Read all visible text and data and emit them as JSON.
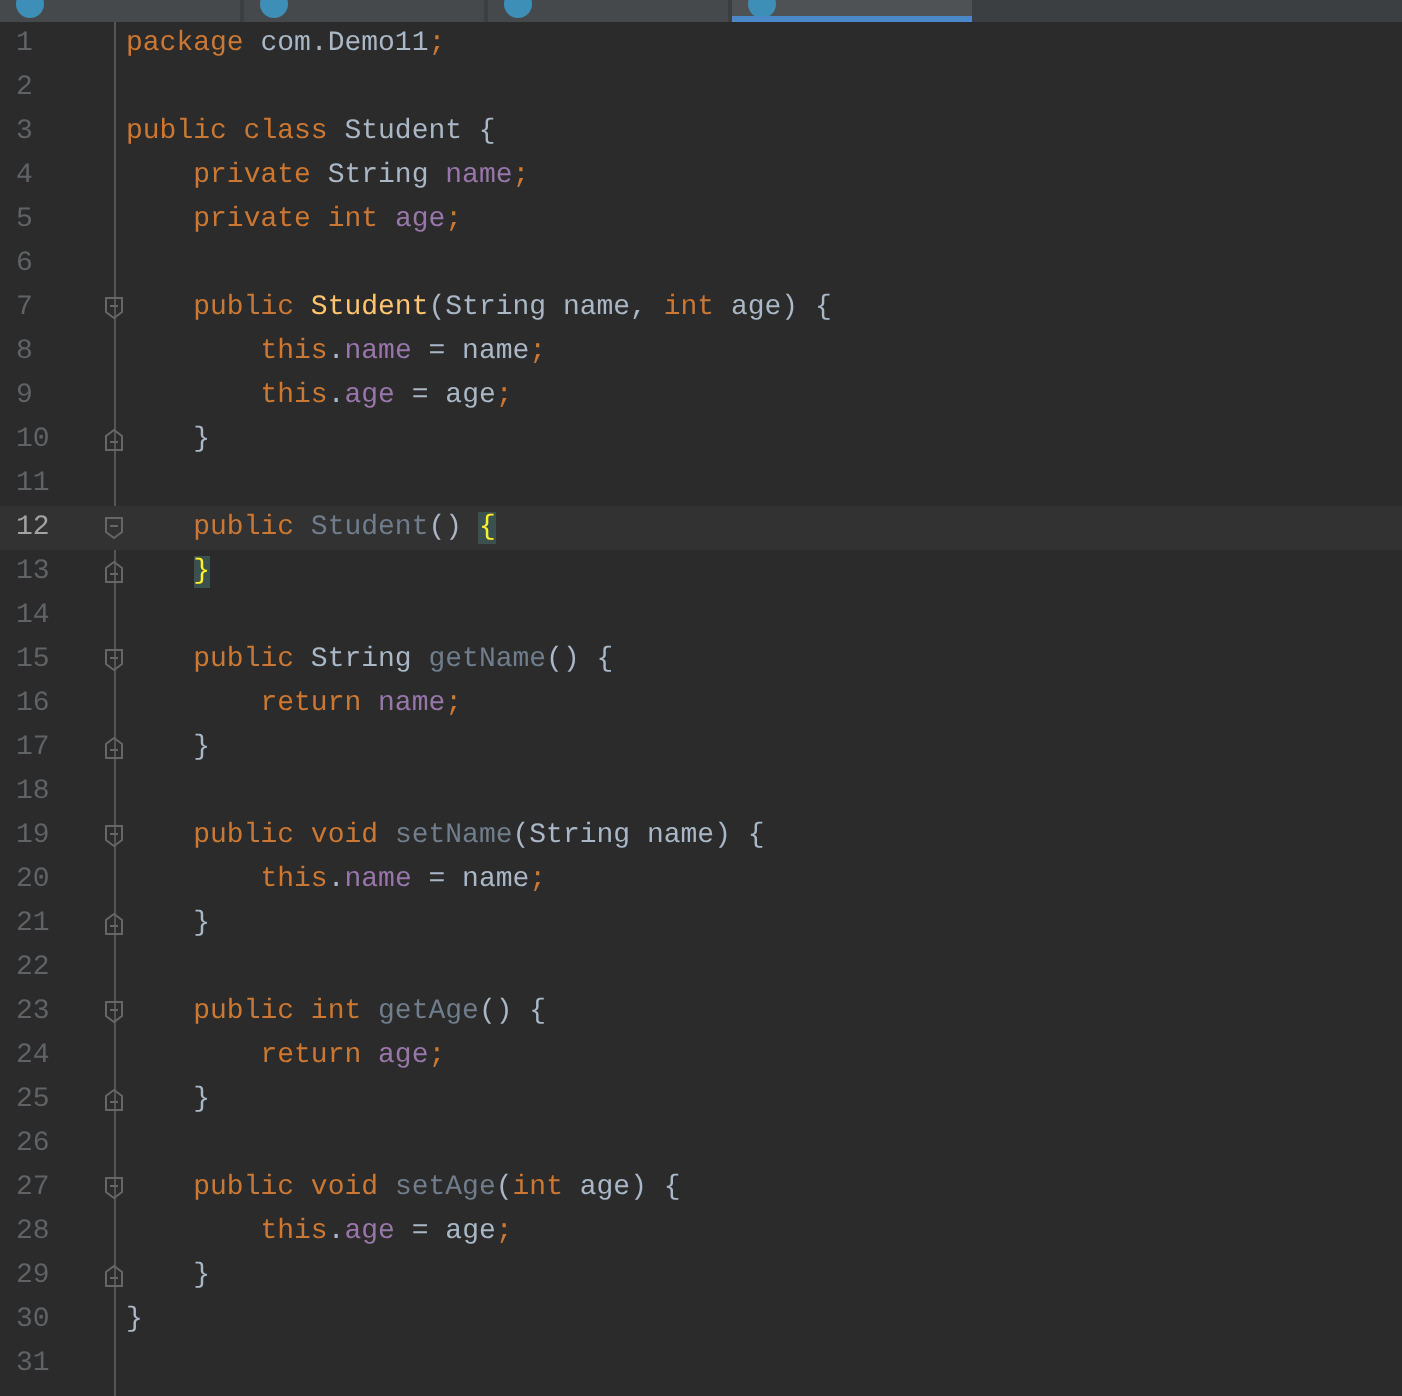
{
  "tabs": [
    {
      "selected": false
    },
    {
      "selected": false
    },
    {
      "selected": false
    },
    {
      "selected": true
    }
  ],
  "editor": {
    "lines": [
      {
        "number": "1",
        "current": false,
        "block_start": false,
        "block_end": false,
        "tokens": [
          {
            "text": "package ",
            "kind": "kw"
          },
          {
            "text": "com.Demo11",
            "kind": "plain"
          },
          {
            "text": ";",
            "kind": "kw"
          }
        ]
      },
      {
        "number": "2",
        "current": false,
        "block_start": false,
        "block_end": false
      },
      {
        "number": "3",
        "current": false,
        "block_start": false,
        "block_end": false,
        "tokens": [
          {
            "text": "public class ",
            "kind": "kw"
          },
          {
            "text": "Student {",
            "kind": "plain"
          }
        ]
      },
      {
        "number": "4",
        "current": false,
        "block_start": false,
        "block_end": false,
        "tokens": [
          {
            "text": "    private ",
            "kind": "kw"
          },
          {
            "text": "String ",
            "kind": "plain"
          },
          {
            "text": "name",
            "kind": "field"
          },
          {
            "text": ";",
            "kind": "kw"
          }
        ]
      },
      {
        "number": "5",
        "current": false,
        "block_start": false,
        "block_end": false,
        "tokens": [
          {
            "text": "    private int ",
            "kind": "kw"
          },
          {
            "text": "age",
            "kind": "field"
          },
          {
            "text": ";",
            "kind": "kw"
          }
        ]
      },
      {
        "number": "6",
        "current": false,
        "block_start": false,
        "block_end": false
      },
      {
        "number": "7",
        "current": false,
        "block_start": true,
        "block_end": false,
        "tokens": [
          {
            "text": "    public ",
            "kind": "kw"
          },
          {
            "text": "Student",
            "kind": "decl"
          },
          {
            "text": "(String name, ",
            "kind": "plain"
          },
          {
            "text": "int ",
            "kind": "kw"
          },
          {
            "text": "age) {",
            "kind": "plain"
          }
        ]
      },
      {
        "number": "8",
        "current": false,
        "block_start": false,
        "block_end": false,
        "tokens": [
          {
            "text": "        this",
            "kind": "kw"
          },
          {
            "text": ".",
            "kind": "plain"
          },
          {
            "text": "name",
            "kind": "field"
          },
          {
            "text": " = name",
            "kind": "plain"
          },
          {
            "text": ";",
            "kind": "kw"
          }
        ]
      },
      {
        "number": "9",
        "current": false,
        "block_start": false,
        "block_end": false,
        "tokens": [
          {
            "text": "        this",
            "kind": "kw"
          },
          {
            "text": ".",
            "kind": "plain"
          },
          {
            "text": "age",
            "kind": "field"
          },
          {
            "text": " = age",
            "kind": "plain"
          },
          {
            "text": ";",
            "kind": "kw"
          }
        ]
      },
      {
        "number": "10",
        "current": false,
        "block_start": false,
        "block_end": true,
        "tokens": [
          {
            "text": "    }",
            "kind": "plain"
          }
        ]
      },
      {
        "number": "11",
        "current": false,
        "block_start": false,
        "block_end": false
      },
      {
        "number": "12",
        "current": true,
        "block_start": true,
        "block_end": false,
        "tokens": [
          {
            "text": "    public ",
            "kind": "kw"
          },
          {
            "text": "Student",
            "kind": "unused"
          },
          {
            "text": "() ",
            "kind": "plain"
          },
          {
            "text": "{",
            "kind": "match"
          }
        ]
      },
      {
        "number": "13",
        "current": false,
        "block_start": false,
        "block_end": true,
        "tokens": [
          {
            "text": "    }",
            "kind": "match"
          }
        ]
      },
      {
        "number": "14",
        "current": false,
        "block_start": false,
        "block_end": false
      },
      {
        "number": "15",
        "current": false,
        "block_start": true,
        "block_end": false,
        "tokens": [
          {
            "text": "    public ",
            "kind": "kw"
          },
          {
            "text": "String ",
            "kind": "plain"
          },
          {
            "text": "getName",
            "kind": "unused"
          },
          {
            "text": "() {",
            "kind": "plain"
          }
        ]
      },
      {
        "number": "16",
        "current": false,
        "block_start": false,
        "block_end": false,
        "tokens": [
          {
            "text": "        return ",
            "kind": "kw"
          },
          {
            "text": "name",
            "kind": "field"
          },
          {
            "text": ";",
            "kind": "kw"
          }
        ]
      },
      {
        "number": "17",
        "current": false,
        "block_start": false,
        "block_end": true,
        "tokens": [
          {
            "text": "    }",
            "kind": "plain"
          }
        ]
      },
      {
        "number": "18",
        "current": false,
        "block_start": false,
        "block_end": false
      },
      {
        "number": "19",
        "current": false,
        "block_start": true,
        "block_end": false,
        "tokens": [
          {
            "text": "    public void ",
            "kind": "kw"
          },
          {
            "text": "setName",
            "kind": "unused"
          },
          {
            "text": "(String name) {",
            "kind": "plain"
          }
        ]
      },
      {
        "number": "20",
        "current": false,
        "block_start": false,
        "block_end": false,
        "tokens": [
          {
            "text": "        this",
            "kind": "kw"
          },
          {
            "text": ".",
            "kind": "plain"
          },
          {
            "text": "name",
            "kind": "field"
          },
          {
            "text": " = name",
            "kind": "plain"
          },
          {
            "text": ";",
            "kind": "kw"
          }
        ]
      },
      {
        "number": "21",
        "current": false,
        "block_start": false,
        "block_end": true,
        "tokens": [
          {
            "text": "    }",
            "kind": "plain"
          }
        ]
      },
      {
        "number": "22",
        "current": false,
        "block_start": false,
        "block_end": false
      },
      {
        "number": "23",
        "current": false,
        "block_start": true,
        "block_end": false,
        "tokens": [
          {
            "text": "    public int ",
            "kind": "kw"
          },
          {
            "text": "getAge",
            "kind": "unused"
          },
          {
            "text": "() {",
            "kind": "plain"
          }
        ]
      },
      {
        "number": "24",
        "current": false,
        "block_start": false,
        "block_end": false,
        "tokens": [
          {
            "text": "        return ",
            "kind": "kw"
          },
          {
            "text": "age",
            "kind": "field"
          },
          {
            "text": ";",
            "kind": "kw"
          }
        ]
      },
      {
        "number": "25",
        "current": false,
        "block_start": false,
        "block_end": true,
        "tokens": [
          {
            "text": "    }",
            "kind": "plain"
          }
        ]
      },
      {
        "number": "26",
        "current": false,
        "block_start": false,
        "block_end": false
      },
      {
        "number": "27",
        "current": false,
        "block_start": true,
        "block_end": false,
        "tokens": [
          {
            "text": "    public void ",
            "kind": "kw"
          },
          {
            "text": "setAge",
            "kind": "unused"
          },
          {
            "text": "(",
            "kind": "plain"
          },
          {
            "text": "int ",
            "kind": "kw"
          },
          {
            "text": "age) {",
            "kind": "plain"
          }
        ]
      },
      {
        "number": "28",
        "current": false,
        "block_start": false,
        "block_end": false,
        "tokens": [
          {
            "text": "        this",
            "kind": "kw"
          },
          {
            "text": ".",
            "kind": "plain"
          },
          {
            "text": "age",
            "kind": "field"
          },
          {
            "text": " = age",
            "kind": "plain"
          },
          {
            "text": ";",
            "kind": "kw"
          }
        ]
      },
      {
        "number": "29",
        "current": false,
        "block_start": false,
        "block_end": true,
        "tokens": [
          {
            "text": "    }",
            "kind": "plain"
          }
        ]
      },
      {
        "number": "30",
        "current": false,
        "block_start": false,
        "block_end": false,
        "tokens": [
          {
            "text": "}",
            "kind": "plain"
          }
        ]
      },
      {
        "number": "31",
        "current": false,
        "block_start": false,
        "block_end": false
      }
    ]
  }
}
